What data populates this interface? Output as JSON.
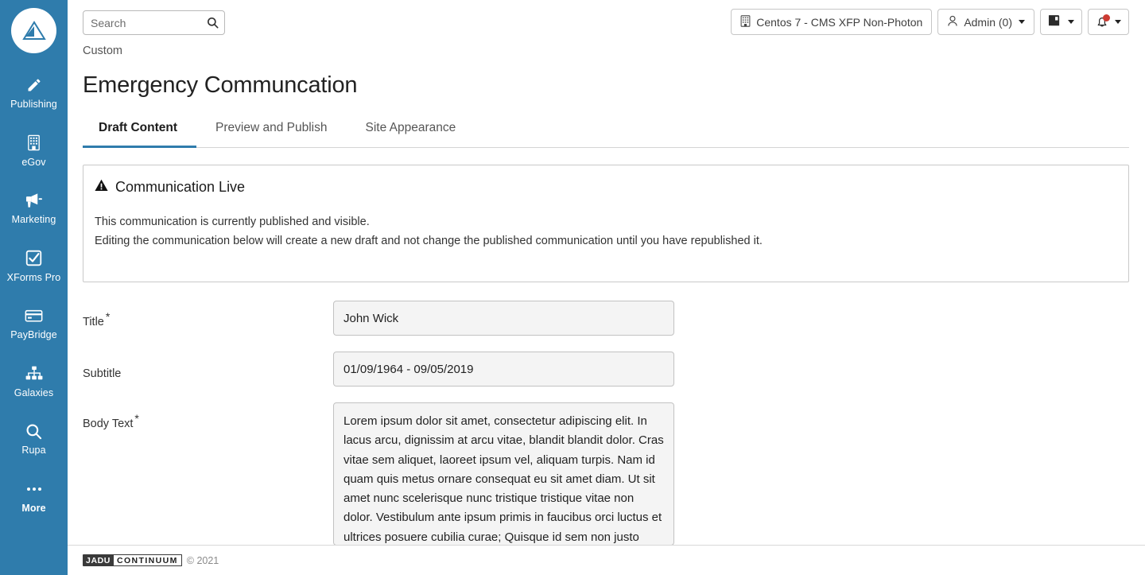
{
  "sidebar": {
    "logo_name": "jadu-triangle-logo",
    "items": [
      {
        "label": "Publishing",
        "icon": "pencil-icon"
      },
      {
        "label": "eGov",
        "icon": "building-icon"
      },
      {
        "label": "Marketing",
        "icon": "megaphone-icon"
      },
      {
        "label": "XForms Pro",
        "icon": "checkbox-checked-icon"
      },
      {
        "label": "PayBridge",
        "icon": "credit-card-icon"
      },
      {
        "label": "Galaxies",
        "icon": "sitemap-icon"
      },
      {
        "label": "Rupa",
        "icon": "search-icon"
      },
      {
        "label": "More",
        "icon": "ellipsis-icon"
      }
    ],
    "background_color": "#2f7cac"
  },
  "topbar": {
    "search": {
      "placeholder": "Search",
      "value": ""
    },
    "site_selector": {
      "label": "Centos 7 - CMS XFP Non-Photon",
      "icon": "building-icon"
    },
    "account": {
      "label": "Admin (0)",
      "icon": "user-icon"
    },
    "library_button": {
      "label": "",
      "icon": "book-icon"
    },
    "notifications": {
      "label": "",
      "icon": "bell-icon",
      "has_unread": true,
      "dot_color": "#cc3b33"
    }
  },
  "page": {
    "breadcrumb": "Custom",
    "title": "Emergency Communcation"
  },
  "tabs": [
    {
      "label": "Draft Content",
      "active": true
    },
    {
      "label": "Preview and Publish",
      "active": false
    },
    {
      "label": "Site Appearance",
      "active": false
    }
  ],
  "alert": {
    "icon": "warning-triangle-icon",
    "heading": "Communication Live",
    "line1": "This communication is currently published and visible.",
    "line2": "Editing the communication below will create a new draft and not change the published communication until you have republished it."
  },
  "form": {
    "title_field": {
      "label": "Title",
      "required": true,
      "required_mark": "*",
      "value": "John Wick"
    },
    "subtitle_field": {
      "label": "Subtitle",
      "required": false,
      "required_mark": "",
      "value": "01/09/1964 - 09/05/2019"
    },
    "body_field": {
      "label": "Body Text",
      "required": true,
      "required_mark": "*",
      "value": "Lorem ipsum dolor sit amet, consectetur adipiscing elit. In lacus arcu, dignissim at arcu vitae, blandit blandit dolor. Cras vitae sem aliquet, laoreet ipsum vel, aliquam turpis. Nam id quam quis metus ornare consequat eu sit amet diam. Ut sit amet nunc scelerisque nunc tristique tristique vitae non dolor. Vestibulum ante ipsum primis in faucibus orci luctus et ultrices posuere cubilia curae; Quisque id sem non justo"
    }
  },
  "footer": {
    "logo_part1": "JADU",
    "logo_part2": "CONTINUUM",
    "copyright": "© 2021"
  },
  "theme": {
    "accent": "#2f7cac",
    "alert_dot": "#cc3b33"
  }
}
